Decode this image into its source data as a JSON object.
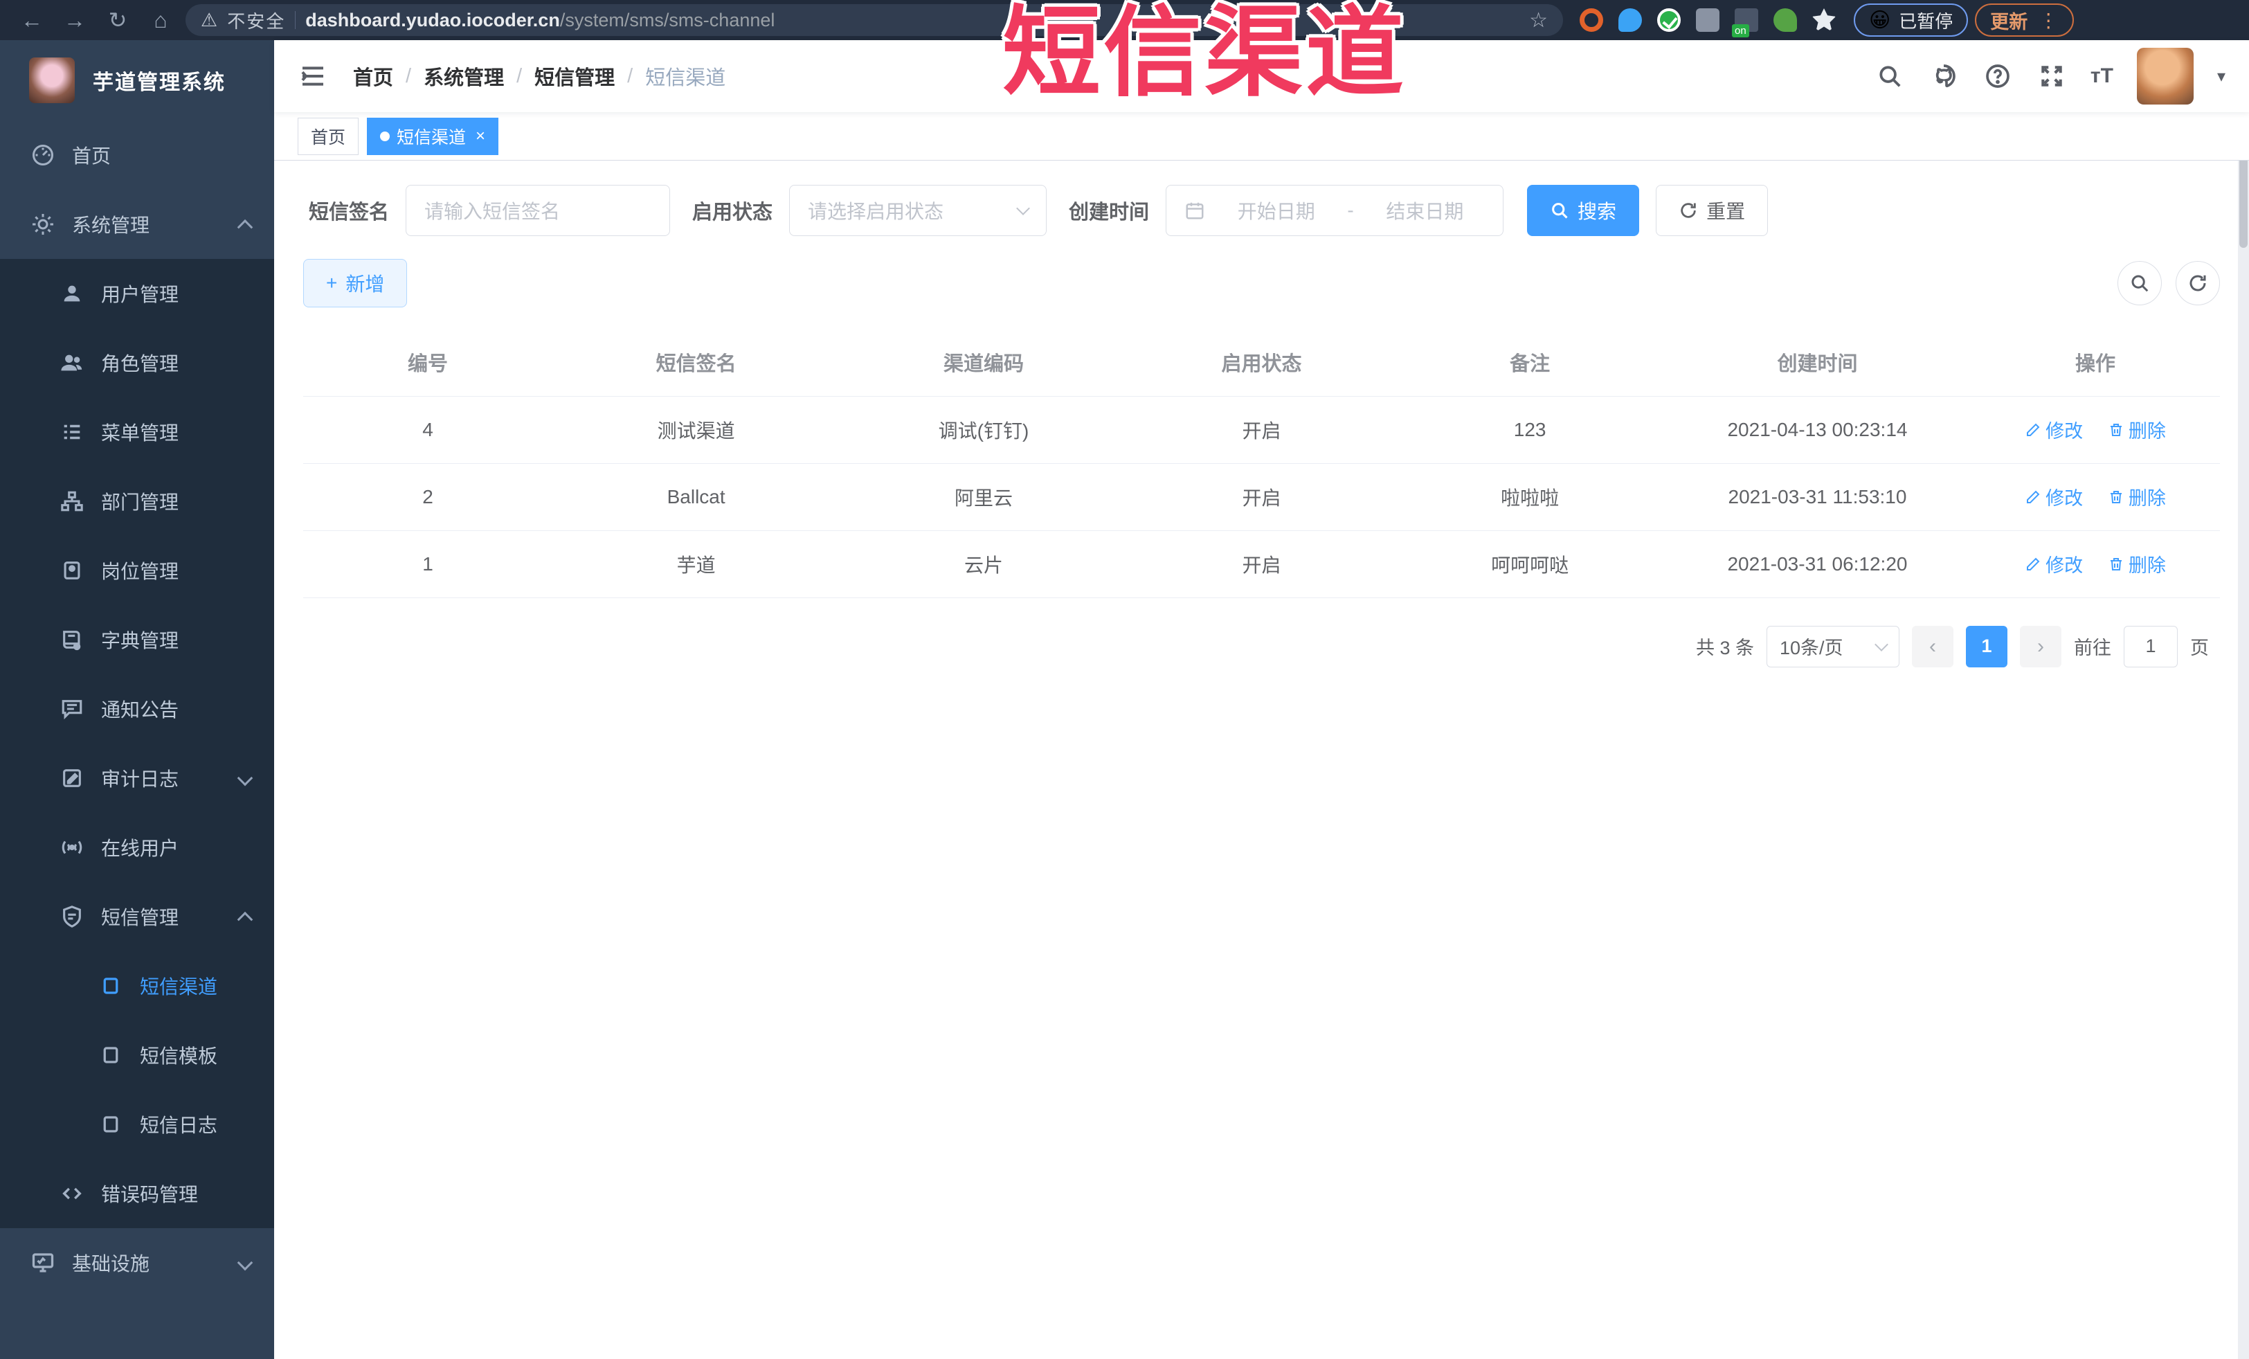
{
  "overlay": {
    "title": "短信渠道",
    "color": "#f03a5e"
  },
  "icons": {
    "back": "←",
    "forward": "→",
    "reload": "↻",
    "home": "⌂",
    "warning": "⚠",
    "star": "☆",
    "caret_down": "▾",
    "close": "×",
    "plus": "+",
    "dot_sep": "-",
    "more_vert": "⋮",
    "font_size": "тT",
    "prev": "‹",
    "next": "›"
  },
  "browser": {
    "security_label": "不安全",
    "url_domain": "dashboard.yudao.iocoder.cn",
    "url_path": "/system/sms/sms-channel",
    "paused_emoji": "😀",
    "paused_label": "已暂停",
    "update_label": "更新"
  },
  "sidebar": {
    "app_title": "芋道管理系统",
    "home_label": "首页",
    "system_label": "系统管理",
    "system_items": [
      "用户管理",
      "角色管理",
      "菜单管理",
      "部门管理",
      "岗位管理",
      "字典管理",
      "通知公告",
      "审计日志",
      "在线用户",
      "短信管理",
      "错误码管理"
    ],
    "sms_items": [
      "短信渠道",
      "短信模板",
      "短信日志"
    ],
    "infra_label": "基础设施"
  },
  "header": {
    "breadcrumb": [
      "首页",
      "系统管理",
      "短信管理",
      "短信渠道"
    ]
  },
  "tags": {
    "home": "首页",
    "active": "短信渠道"
  },
  "filters": {
    "sign_label": "短信签名",
    "sign_placeholder": "请输入短信签名",
    "status_label": "启用状态",
    "status_placeholder": "请选择启用状态",
    "date_label": "创建时间",
    "date_start": "开始日期",
    "date_end": "结束日期",
    "search_label": "搜索",
    "reset_label": "重置"
  },
  "toolbar": {
    "add_label": "新增"
  },
  "table": {
    "columns": [
      "编号",
      "短信签名",
      "渠道编码",
      "启用状态",
      "备注",
      "创建时间",
      "操作"
    ],
    "edit_label": "修改",
    "delete_label": "删除",
    "rows": [
      {
        "id": "4",
        "sign": "测试渠道",
        "code": "调试(钉钉)",
        "status": "开启",
        "remark": "123",
        "created": "2021-04-13 00:23:14"
      },
      {
        "id": "2",
        "sign": "Ballcat",
        "code": "阿里云",
        "status": "开启",
        "remark": "啦啦啦",
        "created": "2021-03-31 11:53:10"
      },
      {
        "id": "1",
        "sign": "芋道",
        "code": "云片",
        "status": "开启",
        "remark": "呵呵呵哒",
        "created": "2021-03-31 06:12:20"
      }
    ]
  },
  "pagination": {
    "total_label": "共 3 条",
    "page_size_label": "10条/页",
    "current_page": "1",
    "goto_label": "前往",
    "goto_value": "1",
    "page_unit": "页"
  },
  "colors": {
    "accent": "#409eff",
    "sidebar_bg": "#304156",
    "submenu_bg": "#1f2d3d",
    "chrome_bg": "#212b3b"
  }
}
